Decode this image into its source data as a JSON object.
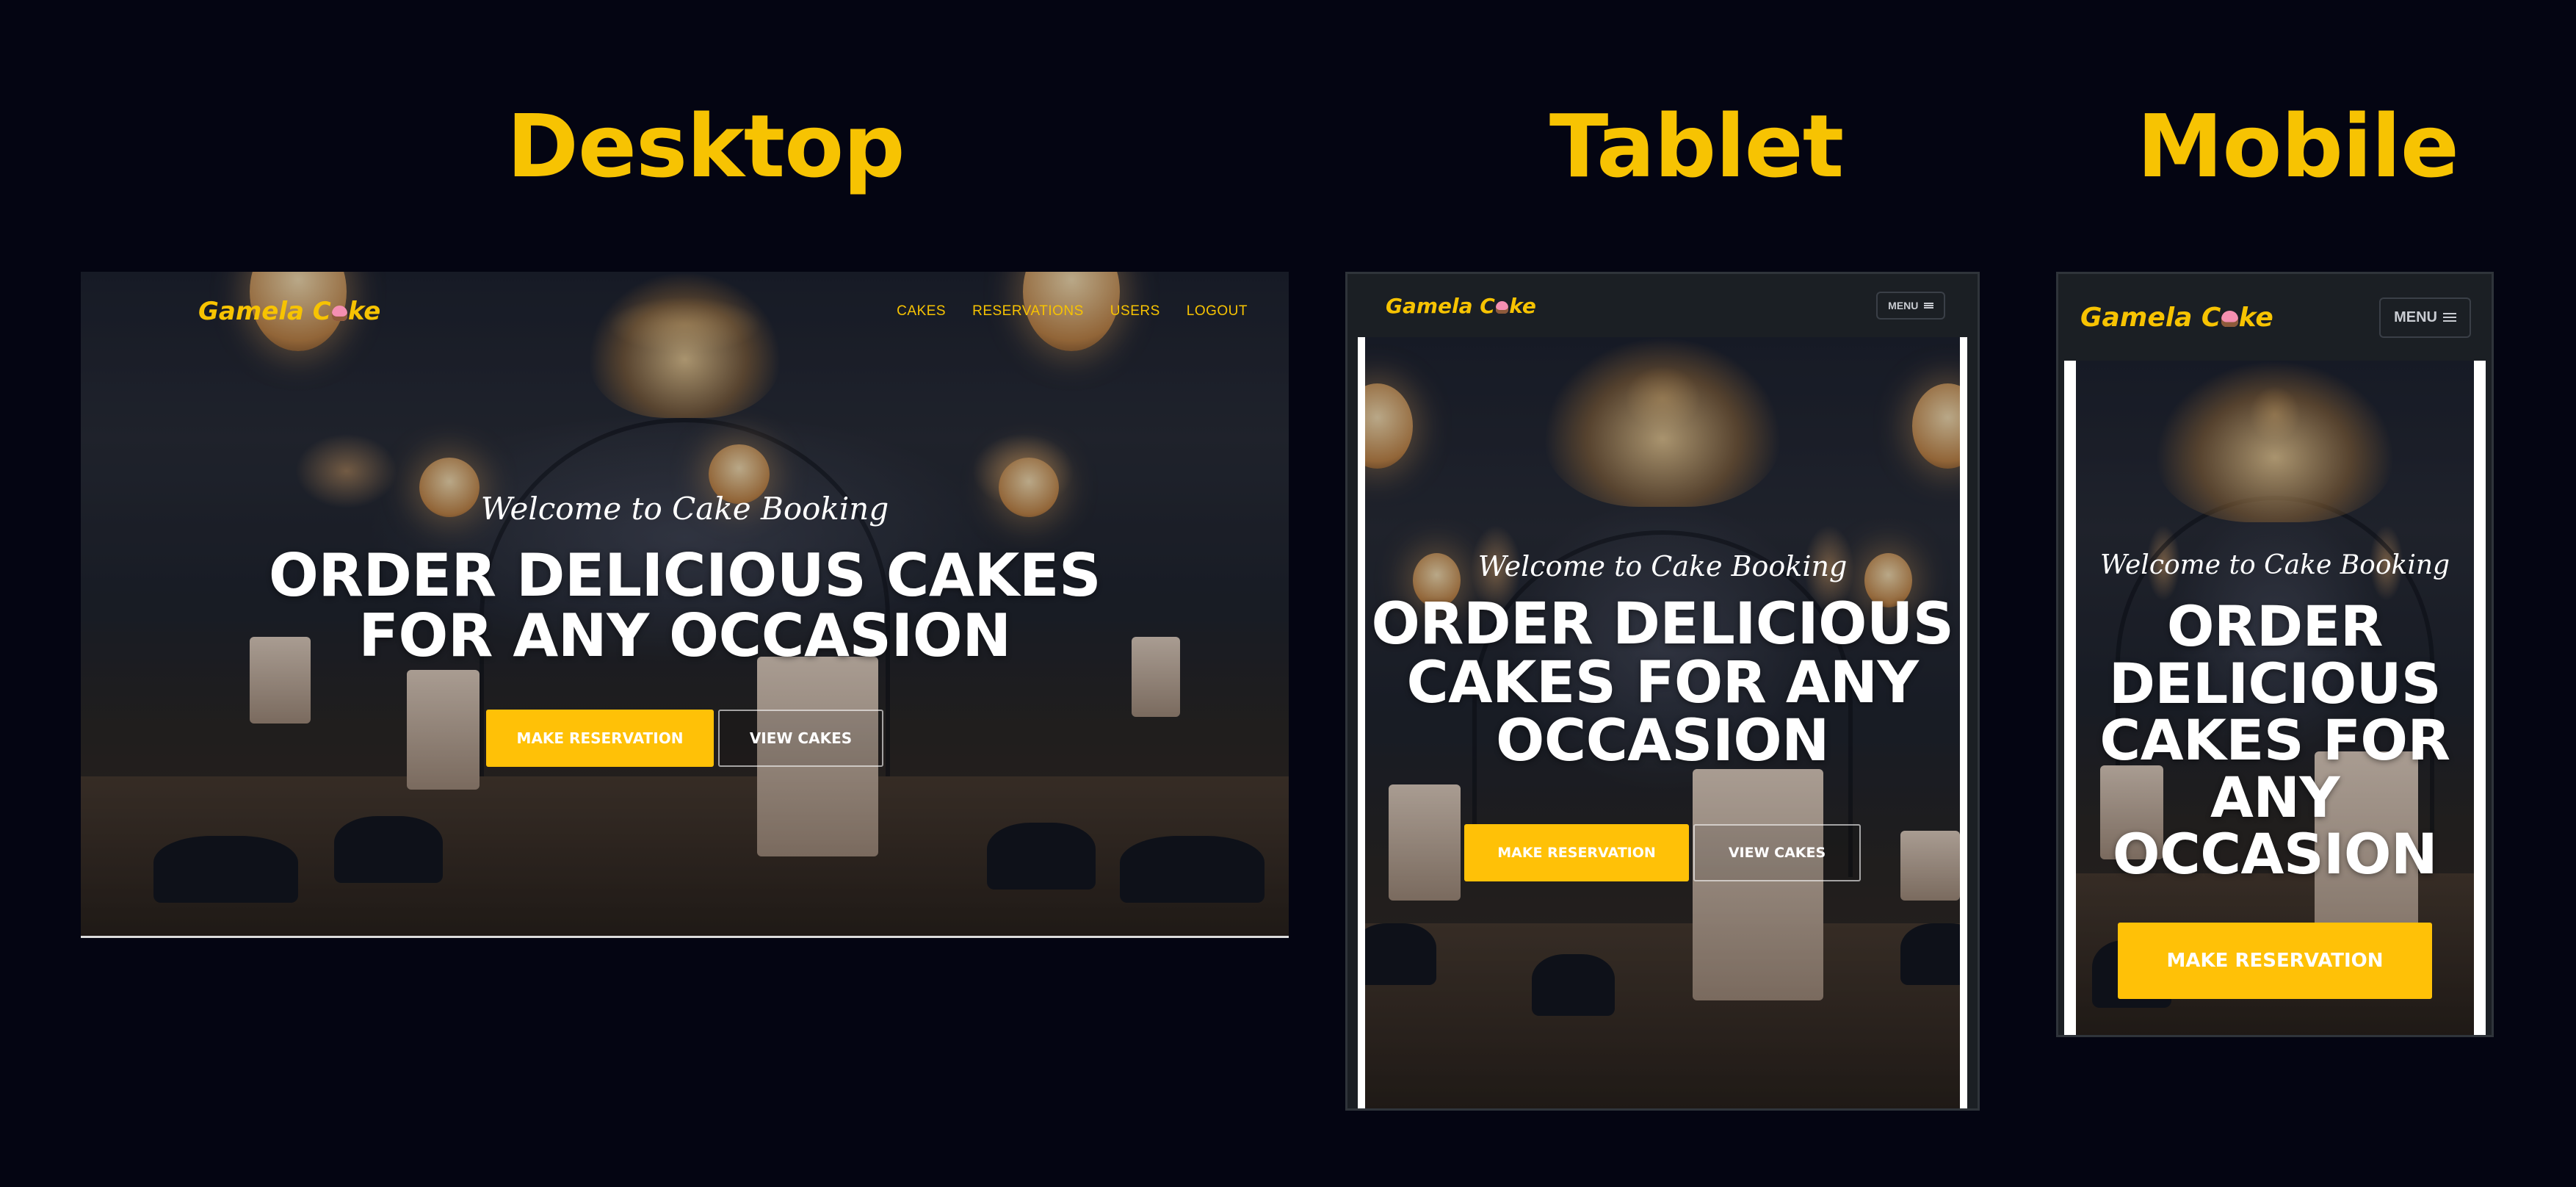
{
  "labels": {
    "desktop": "Desktop",
    "tablet": "Tablet",
    "mobile": "Mobile"
  },
  "brand": {
    "name_before": "Gamela C",
    "name_after": "ke"
  },
  "nav": {
    "links": [
      "CAKES",
      "RESERVATIONS",
      "USERS",
      "LOGOUT"
    ],
    "menu_label": "MENU"
  },
  "hero": {
    "welcome": "Welcome to Cake Booking",
    "headline": "ORDER DELICIOUS CAKES FOR ANY OCCASION",
    "primary_cta": "MAKE RESERVATION",
    "secondary_cta": "VIEW CAKES"
  },
  "icons": {
    "logo_cupcake": "cupcake-icon",
    "menu": "hamburger-icon"
  },
  "colors": {
    "background": "#040512",
    "accent": "#f7c302",
    "button": "#ffc107",
    "navbar": "#1b1f24"
  }
}
